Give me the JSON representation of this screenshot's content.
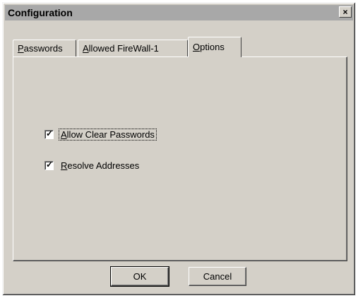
{
  "window": {
    "title": "Configuration",
    "close_symbol": "×"
  },
  "tabs": [
    {
      "label_first": "P",
      "label_rest": "asswords",
      "active": false
    },
    {
      "label_first": "A",
      "label_rest": "llowed FireWall-1",
      "active": false
    },
    {
      "label_first": "O",
      "label_rest": "ptions",
      "active": true
    }
  ],
  "options": {
    "allow_clear": {
      "label_first": "A",
      "label_rest": "llow Clear Passwords",
      "checked": true,
      "check_glyph": "✓"
    },
    "resolve": {
      "label_first": "R",
      "label_rest": "esolve Addresses",
      "checked": true,
      "check_glyph": "✓"
    }
  },
  "buttons": {
    "ok": "OK",
    "cancel": "Cancel"
  },
  "colors": {
    "face": "#d4d0c8",
    "titlebar": "#a8a8a8"
  }
}
